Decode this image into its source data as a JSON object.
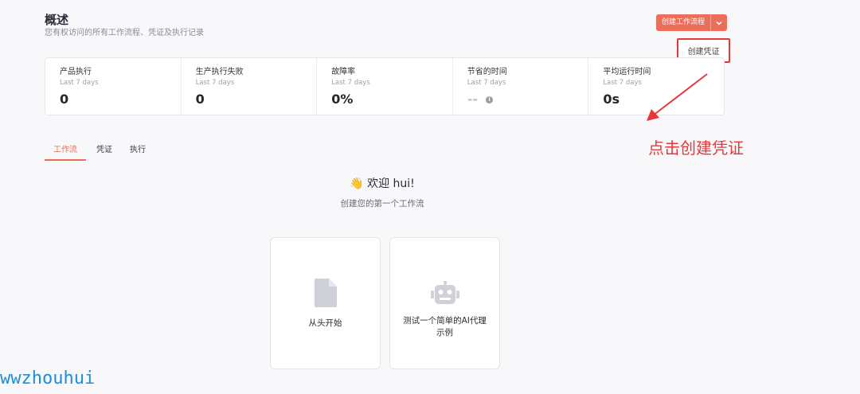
{
  "header": {
    "title": "概述",
    "subtitle": "您有权访问的所有工作流程、凭证及执行记录"
  },
  "actions": {
    "create_workflow_label": "创建工作流程",
    "caret_icon": "chevron-down-icon",
    "dropdown_item_label": "创建凭证"
  },
  "stats": [
    {
      "label": "产品执行",
      "period": "Last 7 days",
      "value": "0"
    },
    {
      "label": "生产执行失败",
      "period": "Last 7 days",
      "value": "0"
    },
    {
      "label": "故障率",
      "period": "Last 7 days",
      "value": "0%"
    },
    {
      "label": "节省的时间",
      "period": "Last 7 days",
      "value": "--",
      "info_icon": "i"
    },
    {
      "label": "平均运行时间",
      "period": "Last 7 days",
      "value": "0s"
    }
  ],
  "tabs": [
    "工作流",
    "凭证",
    "执行"
  ],
  "active_tab": "工作流",
  "welcome": {
    "emoji": "👋",
    "greeting": "欢迎 hui!",
    "subtitle": "创建您的第一个工作流"
  },
  "cards": [
    {
      "icon": "file-icon",
      "label": "从头开始"
    },
    {
      "icon": "robot-icon",
      "label": "测试一个简单的AI代理示例"
    }
  ],
  "annotation": {
    "text": "点击创建凭证",
    "color": "#e8373a"
  },
  "watermark": "wwzhouhui",
  "colors": {
    "accent": "#ea6e5a",
    "annotation_red": "#e8373a",
    "watermark_blue": "#1b8fd9"
  }
}
